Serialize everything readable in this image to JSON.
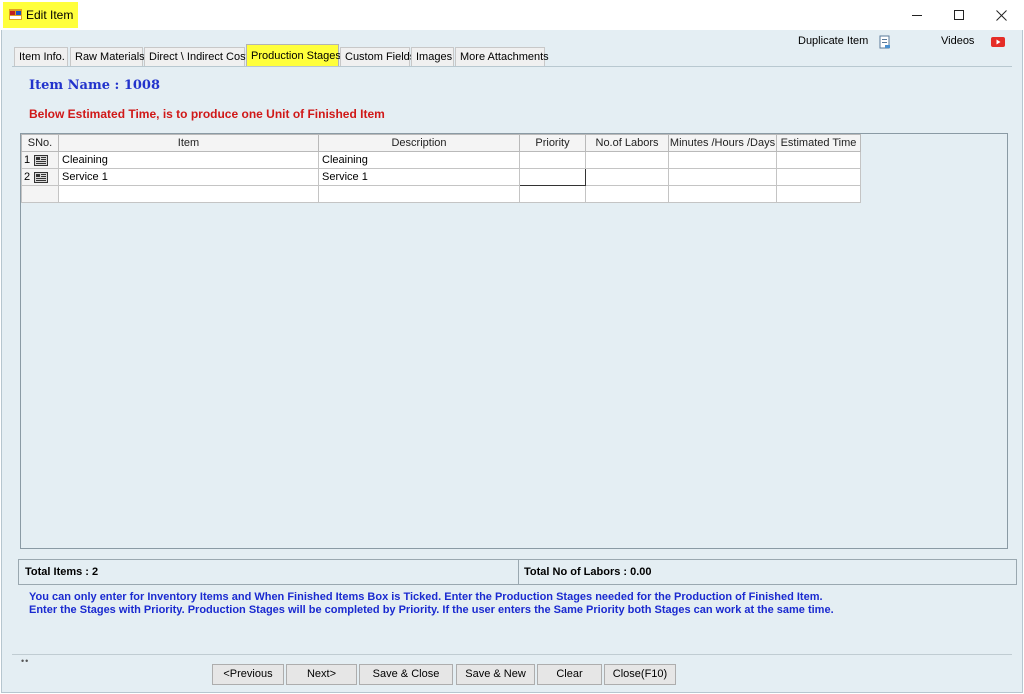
{
  "window": {
    "title": "Edit Item",
    "highlight_color": "#ffff3c",
    "controls": [
      "minimize",
      "maximize",
      "close"
    ]
  },
  "toolbar": {
    "duplicate_item_label": "Duplicate Item",
    "videos_label": "Videos"
  },
  "tabs": [
    {
      "label": "Item Info.",
      "active": false
    },
    {
      "label": "Raw Materials",
      "active": false
    },
    {
      "label": "Direct \\ Indirect Cost",
      "active": false
    },
    {
      "label": "Production Stages",
      "active": true
    },
    {
      "label": "Custom Fields",
      "active": false
    },
    {
      "label": "Images",
      "active": false
    },
    {
      "label": "More Attachments",
      "active": false
    }
  ],
  "main": {
    "item_name": "Item Name : 1008",
    "estimate_note": "Below Estimated Time, is to produce one Unit of Finished Item"
  },
  "grid": {
    "columns": [
      "SNo.",
      "Item",
      "Description",
      "Priority",
      "No.of Labors",
      "Minutes /Hours /Days",
      "Estimated Time"
    ],
    "rows": [
      {
        "sno": "1",
        "item": "Cleaining",
        "description": "Cleaining",
        "priority": "",
        "labors": "",
        "unit": "",
        "estimated_time": ""
      },
      {
        "sno": "2",
        "item": "Service 1",
        "description": "Service 1",
        "priority": "",
        "labors": "",
        "unit": "",
        "estimated_time": ""
      }
    ]
  },
  "totals": {
    "total_items": "Total Items : 2",
    "total_labors": "Total No of Labors : 0.00"
  },
  "info": {
    "line1": "You can only enter for Inventory Items and When Finished Items Box is Ticked. Enter the Production Stages needed for the Production of Finished Item.",
    "line2": "Enter the Stages with Priority. Production Stages will be completed by Priority. If the user enters the Same Priority both Stages can work at the same time."
  },
  "buttons": {
    "previous": "<Previous",
    "next": "Next>",
    "save_close": "Save & Close",
    "save_new": "Save & New",
    "clear": "Clear",
    "close": "Close(F10)"
  },
  "colors": {
    "item_name": "#2233cc",
    "estimate_note": "#d01818",
    "info_text": "#1a2ad0",
    "background": "#e4eef3"
  },
  "icons": [
    "app-icon",
    "duplicate-icon",
    "youtube-icon",
    "row-form-icon"
  ]
}
